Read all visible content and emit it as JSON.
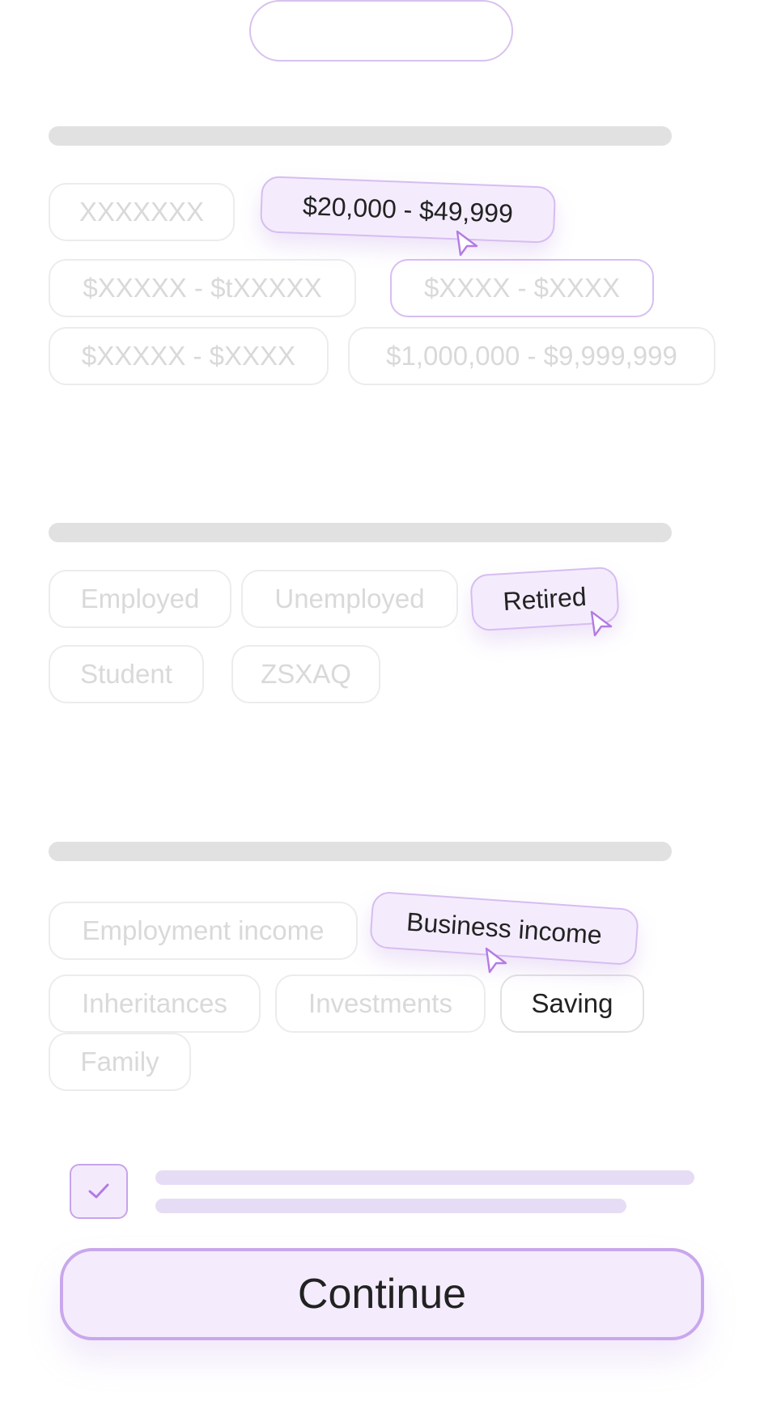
{
  "income_range": {
    "options": [
      "XXXXXXX",
      "$XXXXX - $tXXXXX",
      "$XXXX - $XXXX",
      "$XXXXX - $XXXX",
      "$1,000,000 - $9,999,999"
    ],
    "selected": "$20,000 - $49,999"
  },
  "employment_status": {
    "options": [
      "Employed",
      "Unemployed",
      "Student",
      "ZSXAQ"
    ],
    "selected": "Retired"
  },
  "source_of_funds": {
    "options": [
      "Employment income",
      "Inheritances",
      "Investments",
      "Saving",
      "Family"
    ],
    "selected": "Business income"
  },
  "consent": {
    "checked": true
  },
  "continue_label": "Continue",
  "colors": {
    "accent_border": "#c9a7ec",
    "accent_fill": "#f4ecfd",
    "muted_text": "#d9d9d9",
    "skeleton": "#e1e1e1"
  }
}
